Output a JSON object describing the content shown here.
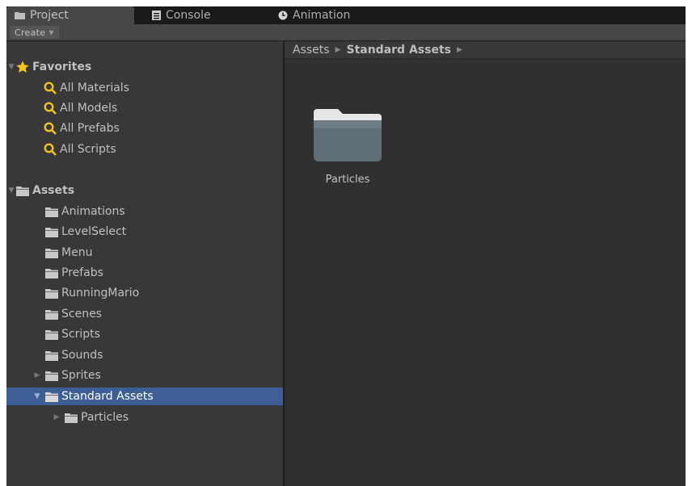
{
  "tabs": [
    {
      "label": "Project",
      "icon": "folder-icon"
    },
    {
      "label": "Console",
      "icon": "console-icon"
    },
    {
      "label": "Animation",
      "icon": "clock-icon"
    }
  ],
  "toolbar": {
    "create_label": "Create"
  },
  "tree": {
    "favorites": {
      "label": "Favorites",
      "items": [
        "All Materials",
        "All Models",
        "All Prefabs",
        "All Scripts"
      ]
    },
    "assets": {
      "label": "Assets",
      "items": [
        "Animations",
        "LevelSelect",
        "Menu",
        "Prefabs",
        "RunningMario",
        "Scenes",
        "Scripts",
        "Sounds",
        "Sprites",
        "Standard Assets"
      ],
      "selected": "Standard Assets",
      "child": "Particles"
    }
  },
  "breadcrumb": [
    "Assets",
    "Standard Assets"
  ],
  "grid": [
    {
      "label": "Particles"
    }
  ],
  "colors": {
    "selection": "#3e5f96",
    "search_icon": "#f1c21b",
    "star": "#f7c516"
  }
}
